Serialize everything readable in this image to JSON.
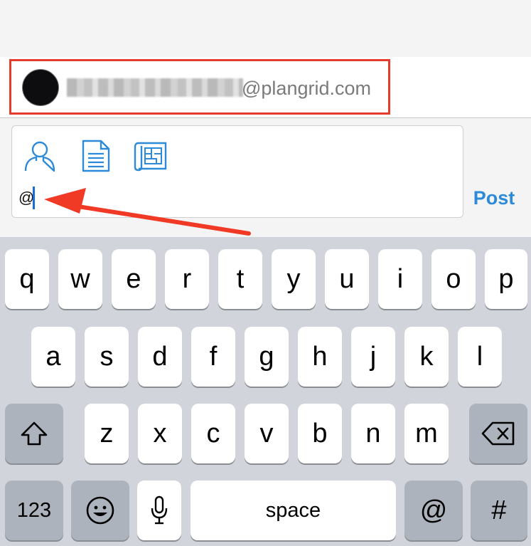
{
  "mention_suggestion": {
    "email_domain": "@plangrid.com",
    "avatar_icon": "avatar"
  },
  "compose": {
    "attach_icons": [
      "person-icon",
      "document-icon",
      "plan-sheet-icon"
    ],
    "input_value": "@",
    "post_label": "Post"
  },
  "colors": {
    "highlight": "#e53b2c",
    "accent": "#2c8ad8",
    "caret": "#1a6ed8"
  },
  "keyboard": {
    "row1": [
      "q",
      "w",
      "e",
      "r",
      "t",
      "y",
      "u",
      "i",
      "o",
      "p"
    ],
    "row2": [
      "a",
      "s",
      "d",
      "f",
      "g",
      "h",
      "j",
      "k",
      "l"
    ],
    "row3": [
      "z",
      "x",
      "c",
      "v",
      "b",
      "n",
      "m"
    ],
    "bottom": {
      "numbers": "123",
      "space": "space",
      "at": "@",
      "hash": "#"
    }
  }
}
